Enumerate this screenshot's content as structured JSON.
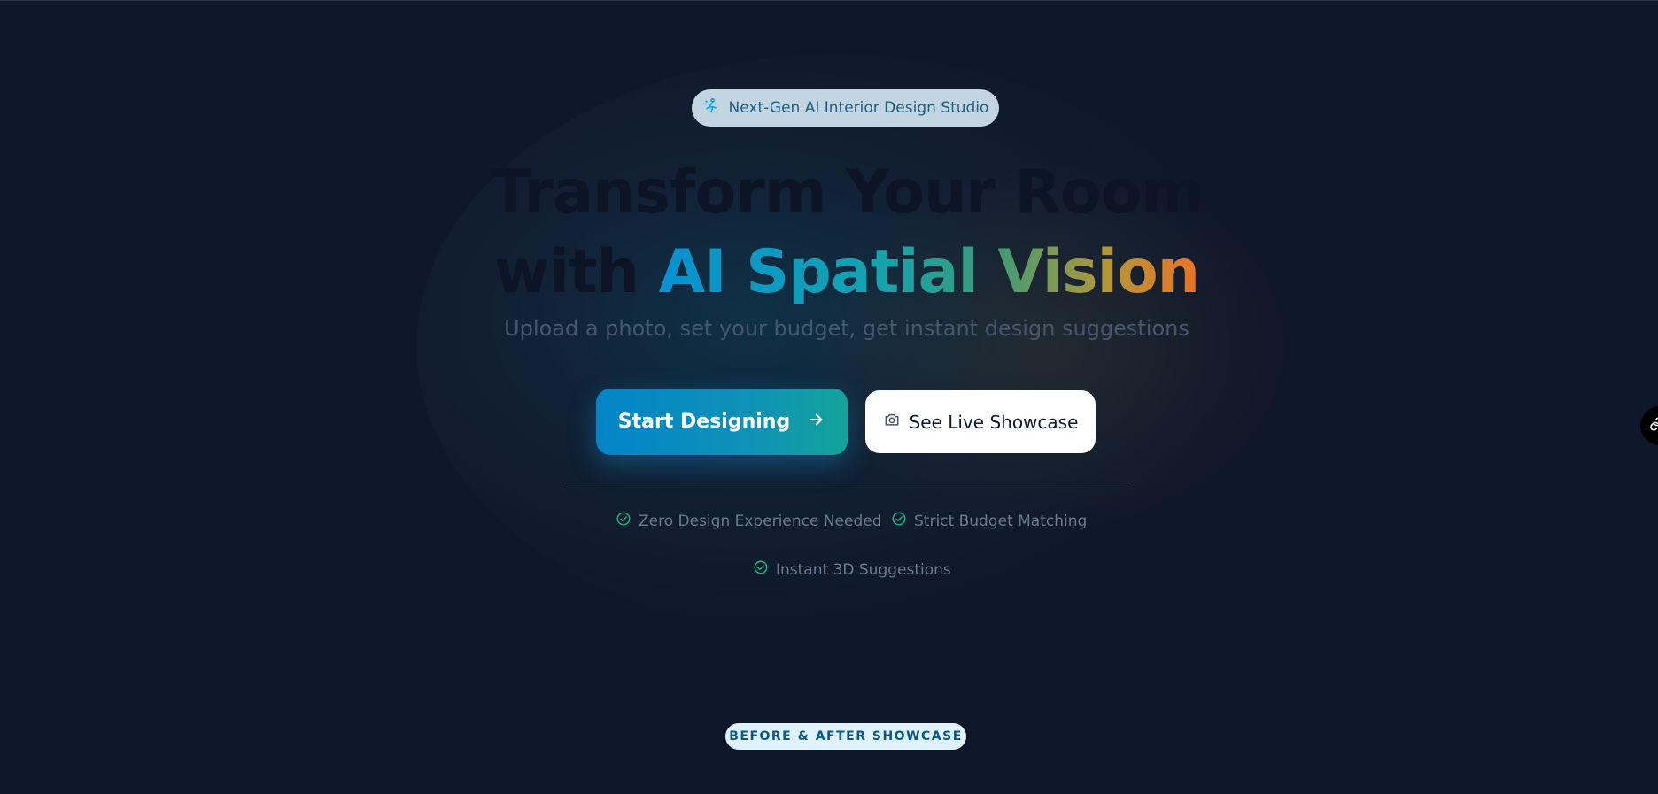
{
  "hero": {
    "badge_text": "Next-Gen AI Interior Design Studio",
    "headline_line1": "Transform Your Room",
    "headline_line2_prefix": "with ",
    "headline_line2_highlight": "AI Spatial Vision",
    "subtitle": "Upload a photo, set your budget, get instant design suggestions",
    "primary_button_label": "Start Designing",
    "secondary_button_label": "See Live Showcase"
  },
  "features": [
    {
      "label": "Zero Design Experience Needed",
      "icon": "check-circle-icon"
    },
    {
      "label": "Strict Budget Matching",
      "icon": "check-circle-icon"
    },
    {
      "label": "Instant 3D Suggestions",
      "icon": "check-circle-icon"
    }
  ],
  "showcase": {
    "section_badge": "BEFORE & AFTER SHOWCASE"
  },
  "icons": {
    "badge": "sparkle-person-icon",
    "primary_button": "arrow-right-icon",
    "secondary_button": "camera-icon",
    "side_widget": "link-icon"
  },
  "colors": {
    "background": "#0f172a",
    "accent_blue": "#0284c7",
    "accent_orange": "#ea7324",
    "check_green": "#10b981",
    "badge_bg": "#c2d5e1"
  }
}
